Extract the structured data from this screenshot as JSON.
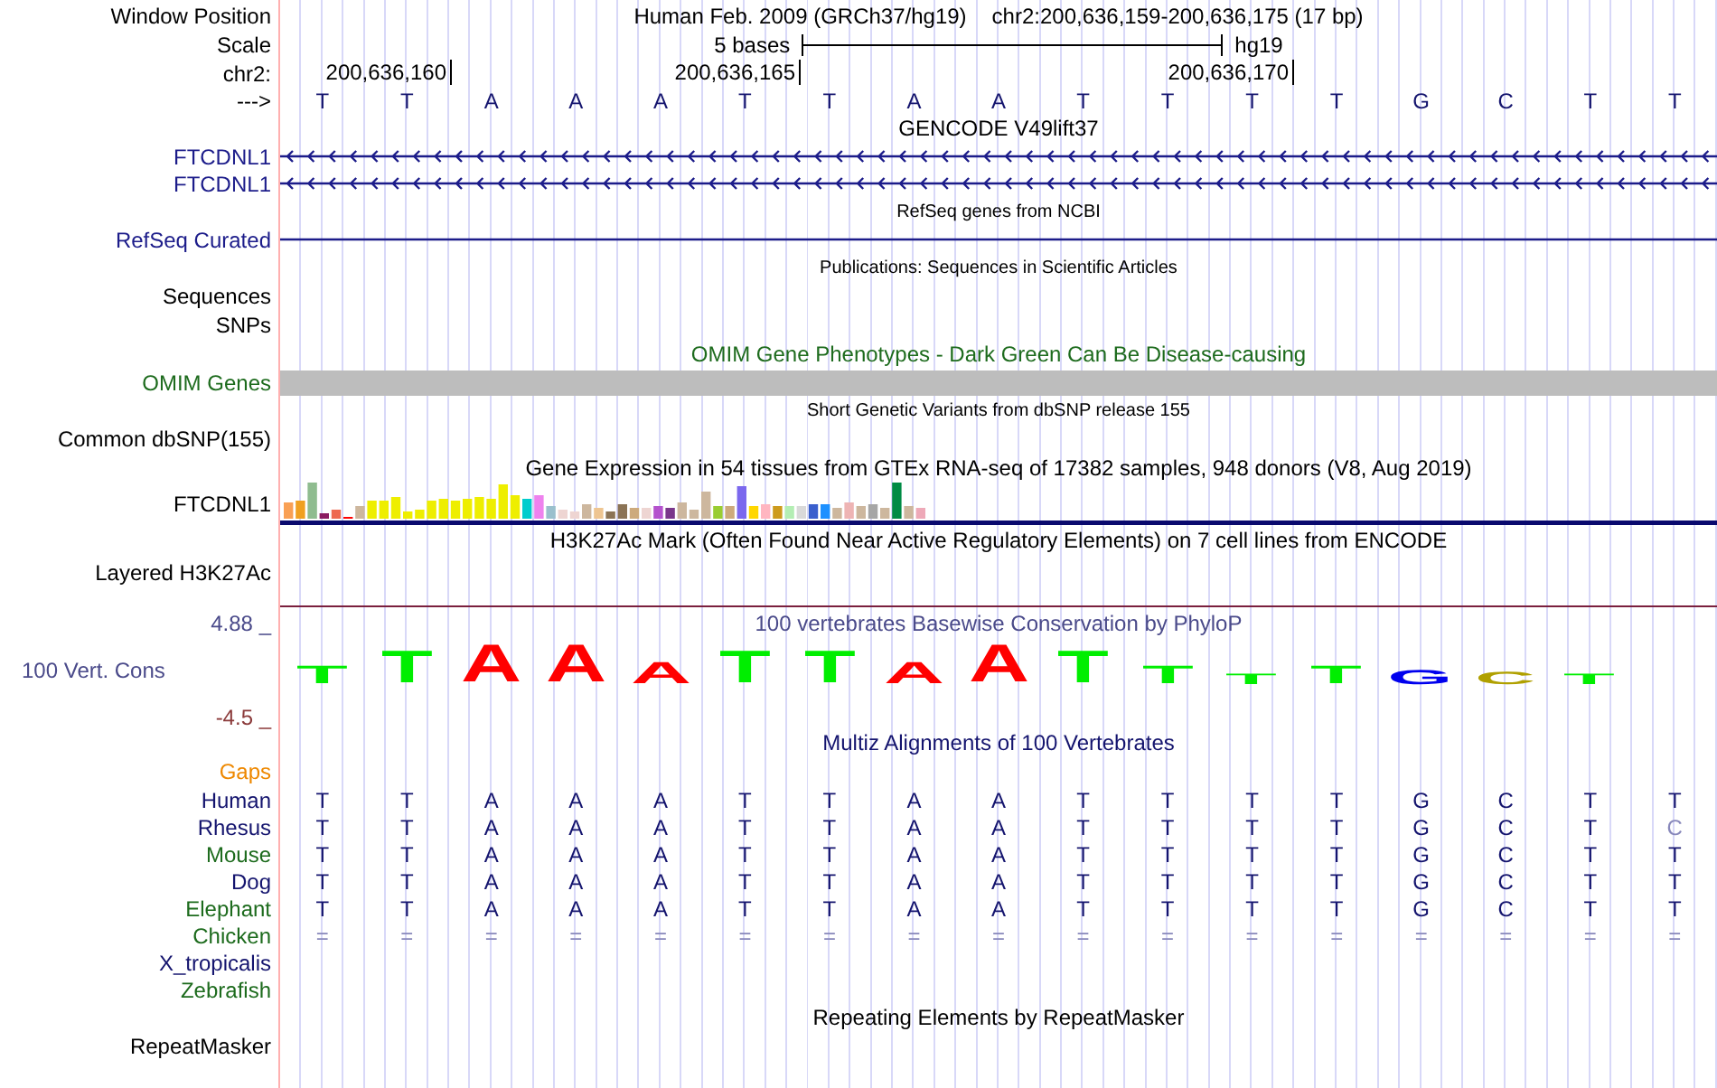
{
  "header": {
    "position_label": "Window Position",
    "assembly": "Human Feb. 2009 (GRCh37/hg19)",
    "range": "chr2:200,636,159-200,636,175 (17 bp)",
    "scale_label": "Scale",
    "scale_text": "5 bases",
    "scale_db": "hg19",
    "chrom_label": "chr2:",
    "ticks": [
      "200,636,160",
      "200,636,165",
      "200,636,170"
    ],
    "strand_label": "--->",
    "bases": [
      "T",
      "T",
      "A",
      "A",
      "A",
      "T",
      "T",
      "A",
      "A",
      "T",
      "T",
      "T",
      "T",
      "G",
      "C",
      "T",
      "T"
    ]
  },
  "tracks": [
    {
      "kind": "title",
      "text": "GENCODE V49lift37",
      "small": false,
      "color": "#000000"
    },
    {
      "kind": "gene",
      "label": "FTCDNL1",
      "color": "#1c1c8a"
    },
    {
      "kind": "gene",
      "label": "FTCDNL1",
      "color": "#1c1c8a"
    },
    {
      "kind": "title",
      "text": "RefSeq genes from NCBI",
      "small": true,
      "color": "#000000"
    },
    {
      "kind": "line",
      "label": "RefSeq Curated",
      "color": "#1c1c8a"
    },
    {
      "kind": "title",
      "text": "Publications: Sequences in Scientific Articles",
      "small": true,
      "color": "#000000"
    },
    {
      "kind": "label",
      "label": "Sequences",
      "color": "#000000"
    },
    {
      "kind": "label",
      "label": "SNPs",
      "color": "#000000"
    },
    {
      "kind": "title",
      "text": "OMIM Gene Phenotypes - Dark Green Can Be Disease-causing",
      "small": false,
      "color": "#1d6b1d"
    },
    {
      "kind": "bar",
      "label": "OMIM Genes",
      "color": "#1d6b1d"
    },
    {
      "kind": "title",
      "text": "Short Genetic Variants from dbSNP release 155",
      "small": true,
      "color": "#000000"
    },
    {
      "kind": "label",
      "label": "Common dbSNP(155)",
      "color": "#000000"
    },
    {
      "kind": "title",
      "text": "Gene Expression in 54 tissues from GTEx RNA-seq of 17382 samples, 948 donors (V8, Aug 2019)",
      "small": false,
      "color": "#000000"
    },
    {
      "kind": "expression",
      "label": "FTCDNL1",
      "color": "#000000"
    },
    {
      "kind": "title",
      "text": "H3K27Ac Mark (Often Found Near Active Regulatory Elements) on 7 cell lines from ENCODE",
      "small": false,
      "color": "#000000"
    },
    {
      "kind": "layered",
      "label": "Layered H3K27Ac",
      "color": "#000000"
    },
    {
      "kind": "conservation",
      "label": "100 Vert. Cons",
      "color": "#4a4a8a",
      "title": "100 vertebrates Basewise Conservation by PhyloP",
      "max": "4.88 _",
      "min": "-4.5 _",
      "letters": [
        {
          "base": "T",
          "color": "#00ee00"
        },
        {
          "base": "T",
          "color": "#00ee00"
        },
        {
          "base": "A",
          "color": "#ff0000"
        },
        {
          "base": "A",
          "color": "#ff0000"
        },
        {
          "base": "A",
          "color": "#ff0000"
        },
        {
          "base": "T",
          "color": "#00ee00"
        },
        {
          "base": "T",
          "color": "#00ee00"
        },
        {
          "base": "A",
          "color": "#ff0000"
        },
        {
          "base": "A",
          "color": "#ff0000"
        },
        {
          "base": "T",
          "color": "#00ee00"
        },
        {
          "base": "T",
          "color": "#00ee00"
        },
        {
          "base": "T",
          "color": "#00ee00"
        },
        {
          "base": "T",
          "color": "#00ee00"
        },
        {
          "base": "G",
          "color": "#0000ee"
        },
        {
          "base": "C",
          "color": "#b0a000"
        },
        {
          "base": "T",
          "color": "#00ee00"
        }
      ]
    },
    {
      "kind": "title",
      "text": "Multiz Alignments of 100 Vertebrates",
      "small": false,
      "color": "#14146e"
    },
    {
      "kind": "label",
      "label": "Gaps",
      "color": "#ee8800"
    },
    {
      "kind": "species",
      "label": "Human",
      "color": "#14146e",
      "bases": [
        {
          "base": "T",
          "differs": false
        },
        {
          "base": "T",
          "differs": false
        },
        {
          "base": "A",
          "differs": false
        },
        {
          "base": "A",
          "differs": false
        },
        {
          "base": "A",
          "differs": false
        },
        {
          "base": "T",
          "differs": false
        },
        {
          "base": "T",
          "differs": false
        },
        {
          "base": "A",
          "differs": false
        },
        {
          "base": "A",
          "differs": false
        },
        {
          "base": "T",
          "differs": false
        },
        {
          "base": "T",
          "differs": false
        },
        {
          "base": "T",
          "differs": false
        },
        {
          "base": "T",
          "differs": false
        },
        {
          "base": "G",
          "differs": false
        },
        {
          "base": "C",
          "differs": false
        },
        {
          "base": "T",
          "differs": false
        },
        {
          "base": "T",
          "differs": false
        }
      ]
    },
    {
      "kind": "species",
      "label": "Rhesus",
      "color": "#14146e",
      "bases": [
        {
          "base": "T",
          "differs": false
        },
        {
          "base": "T",
          "differs": false
        },
        {
          "base": "A",
          "differs": false
        },
        {
          "base": "A",
          "differs": false
        },
        {
          "base": "A",
          "differs": false
        },
        {
          "base": "T",
          "differs": false
        },
        {
          "base": "T",
          "differs": false
        },
        {
          "base": "A",
          "differs": false
        },
        {
          "base": "A",
          "differs": false
        },
        {
          "base": "T",
          "differs": false
        },
        {
          "base": "T",
          "differs": false
        },
        {
          "base": "T",
          "differs": false
        },
        {
          "base": "T",
          "differs": false
        },
        {
          "base": "G",
          "differs": false
        },
        {
          "base": "C",
          "differs": false
        },
        {
          "base": "T",
          "differs": false
        },
        {
          "base": "C",
          "differs": true
        }
      ]
    },
    {
      "kind": "species",
      "label": "Mouse",
      "color": "#1d6b1d",
      "bases": [
        {
          "base": "T",
          "differs": false
        },
        {
          "base": "T",
          "differs": false
        },
        {
          "base": "A",
          "differs": false
        },
        {
          "base": "A",
          "differs": false
        },
        {
          "base": "A",
          "differs": false
        },
        {
          "base": "T",
          "differs": false
        },
        {
          "base": "T",
          "differs": false
        },
        {
          "base": "A",
          "differs": false
        },
        {
          "base": "A",
          "differs": false
        },
        {
          "base": "T",
          "differs": false
        },
        {
          "base": "T",
          "differs": false
        },
        {
          "base": "T",
          "differs": false
        },
        {
          "base": "T",
          "differs": false
        },
        {
          "base": "G",
          "differs": false
        },
        {
          "base": "C",
          "differs": false
        },
        {
          "base": "T",
          "differs": false
        },
        {
          "base": "T",
          "differs": false
        }
      ]
    },
    {
      "kind": "species",
      "label": "Dog",
      "color": "#14146e",
      "bases": [
        {
          "base": "T",
          "differs": false
        },
        {
          "base": "T",
          "differs": false
        },
        {
          "base": "A",
          "differs": false
        },
        {
          "base": "A",
          "differs": false
        },
        {
          "base": "A",
          "differs": false
        },
        {
          "base": "T",
          "differs": false
        },
        {
          "base": "T",
          "differs": false
        },
        {
          "base": "A",
          "differs": false
        },
        {
          "base": "A",
          "differs": false
        },
        {
          "base": "T",
          "differs": false
        },
        {
          "base": "T",
          "differs": false
        },
        {
          "base": "T",
          "differs": false
        },
        {
          "base": "T",
          "differs": false
        },
        {
          "base": "G",
          "differs": false
        },
        {
          "base": "C",
          "differs": false
        },
        {
          "base": "T",
          "differs": false
        },
        {
          "base": "T",
          "differs": false
        }
      ]
    },
    {
      "kind": "species",
      "label": "Elephant",
      "color": "#1d6b1d",
      "bases": [
        {
          "base": "T",
          "differs": false
        },
        {
          "base": "T",
          "differs": false
        },
        {
          "base": "A",
          "differs": false
        },
        {
          "base": "A",
          "differs": false
        },
        {
          "base": "A",
          "differs": false
        },
        {
          "base": "T",
          "differs": false
        },
        {
          "base": "T",
          "differs": false
        },
        {
          "base": "A",
          "differs": false
        },
        {
          "base": "A",
          "differs": false
        },
        {
          "base": "T",
          "differs": false
        },
        {
          "base": "T",
          "differs": false
        },
        {
          "base": "T",
          "differs": false
        },
        {
          "base": "T",
          "differs": false
        },
        {
          "base": "G",
          "differs": false
        },
        {
          "base": "C",
          "differs": false
        },
        {
          "base": "T",
          "differs": false
        },
        {
          "base": "T",
          "differs": false
        }
      ]
    },
    {
      "kind": "species",
      "label": "Chicken",
      "color": "#1d6b1d",
      "bases": [
        {
          "base": "=",
          "differs": true
        },
        {
          "base": "=",
          "differs": true
        },
        {
          "base": "=",
          "differs": true
        },
        {
          "base": "=",
          "differs": true
        },
        {
          "base": "=",
          "differs": true
        },
        {
          "base": "=",
          "differs": true
        },
        {
          "base": "=",
          "differs": true
        },
        {
          "base": "=",
          "differs": true
        },
        {
          "base": "=",
          "differs": true
        },
        {
          "base": "=",
          "differs": true
        },
        {
          "base": "=",
          "differs": true
        },
        {
          "base": "=",
          "differs": true
        },
        {
          "base": "=",
          "differs": true
        },
        {
          "base": "=",
          "differs": true
        },
        {
          "base": "=",
          "differs": true
        },
        {
          "base": "=",
          "differs": true
        },
        {
          "base": "=",
          "differs": true
        }
      ]
    },
    {
      "kind": "species",
      "label": "X_tropicalis",
      "color": "#14146e"
    },
    {
      "kind": "species",
      "label": "Zebrafish",
      "color": "#1d6b1d"
    },
    {
      "kind": "title",
      "text": "Repeating Elements by RepeatMasker",
      "small": false,
      "color": "#000000"
    },
    {
      "kind": "label",
      "label": "RepeatMasker",
      "color": "#000000"
    }
  ]
}
